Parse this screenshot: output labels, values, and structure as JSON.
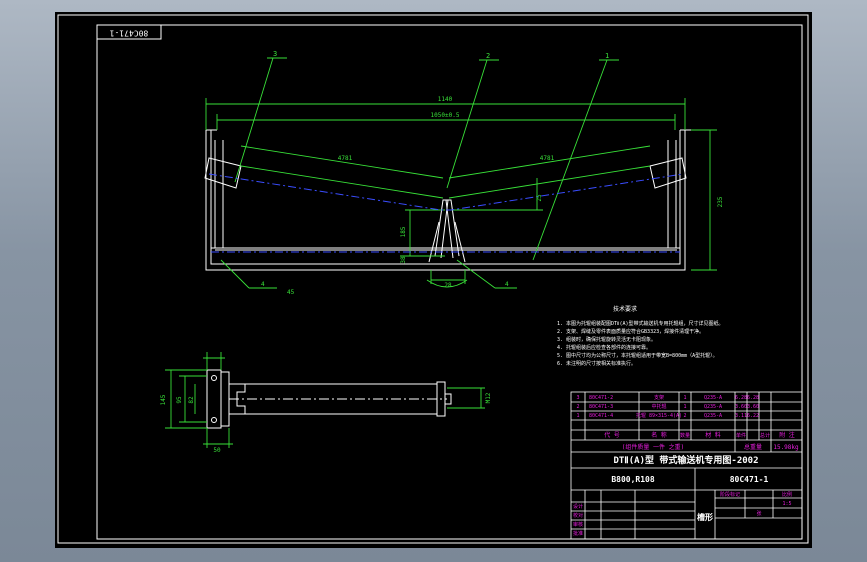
{
  "drawing": {
    "corner_stamp": "80C471-1",
    "balloons": [
      "3",
      "2",
      "1"
    ],
    "dimensions": {
      "overall_width": "1140",
      "inner_width": "1050±0.5",
      "slope_left": "4781",
      "slope_right": "4781",
      "height_right": "235",
      "height_mid": "185",
      "small_a": "25",
      "small_b": "38",
      "bottom": "28",
      "angle": "45",
      "side_height": "145",
      "side_width": "95",
      "side_depth": "82",
      "side_flange": "50",
      "shaft": "M12"
    },
    "callout_bottom_left": "4",
    "callout_bottom_right": "4",
    "notes_title": "技术要求",
    "notes": [
      "1. 本图为托辊组装配图DTⅡ(A)型带式输送机专用托辊组，尺寸详见图纸。",
      "2. 支架、焊缝及零件表面质量应符合GB3323，焊接件清理干净。",
      "3. 组装时，确保托辊旋转灵活无卡阻现象。",
      "4. 托辊组装后应检查各部件的连接可靠。",
      "5. 图中尺寸均为公称尺寸，本托辊组适用于带宽B=800mm（A型托辊）。",
      "6. 未注明的尺寸按相关标准执行。"
    ]
  },
  "title_block": {
    "parts": [
      {
        "no": "3",
        "code": "80C471-2",
        "name": "支架",
        "qty": "1",
        "material": "Q235-A",
        "mass": "6.28",
        "total": "6.28"
      },
      {
        "no": "2",
        "code": "80C471-3",
        "name": "中托辊",
        "qty": "1",
        "material": "Q235-A",
        "mass": "3.60",
        "total": "3.60"
      },
      {
        "no": "1",
        "code": "80C471-4",
        "name": "托辊 89×315-4(A)",
        "qty": "2",
        "material": "Q235-A",
        "mass": "3.11",
        "total": "6.22"
      }
    ],
    "header_cols": [
      "代 号",
      "名 称",
      "数量",
      "材 料",
      "单件",
      "总计",
      "附 注"
    ],
    "mass_label": "总重量",
    "mass_value": "15.98kg",
    "mass_note": "(组件质量 一件 之重)",
    "series_title": "DTⅡ(A)型 带式输送机专用图-2002",
    "spec": "B800,R108",
    "drawing_no": "80C471-1",
    "part_name": "槽形",
    "scale_label": "比例",
    "scale_value": "1:5",
    "sheet_label": "张",
    "rows_left": [
      "设计",
      "校对",
      "审核",
      "批准"
    ],
    "stage_label": "阶段标记"
  }
}
